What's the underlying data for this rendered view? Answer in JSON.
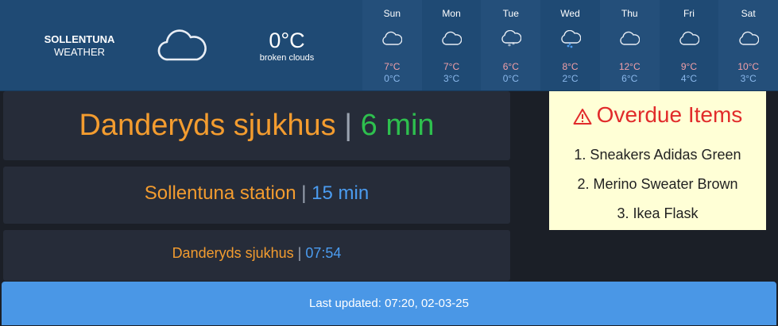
{
  "weather": {
    "city": "SOLLENTUNA",
    "subtitle": "WEATHER",
    "current_temp": "0°C",
    "current_desc": "broken clouds",
    "current_icon": "cloud-icon",
    "forecast": [
      {
        "day": "Sun",
        "icon": "cloud-icon",
        "hi": "7°C",
        "lo": "0°C"
      },
      {
        "day": "Mon",
        "icon": "cloud-icon",
        "hi": "7°C",
        "lo": "3°C"
      },
      {
        "day": "Tue",
        "icon": "snow-cloud-icon",
        "hi": "6°C",
        "lo": "0°C"
      },
      {
        "day": "Wed",
        "icon": "rain-cloud-icon",
        "hi": "8°C",
        "lo": "2°C"
      },
      {
        "day": "Thu",
        "icon": "cloud-icon",
        "hi": "12°C",
        "lo": "6°C"
      },
      {
        "day": "Fri",
        "icon": "cloud-icon",
        "hi": "9°C",
        "lo": "4°C"
      },
      {
        "day": "Sat",
        "icon": "cloud-icon",
        "hi": "10°C",
        "lo": "3°C"
      }
    ]
  },
  "transit": [
    {
      "place": "Danderyds sjukhus",
      "separator": "|",
      "time": "6 min"
    },
    {
      "place": "Sollentuna station",
      "separator": "|",
      "time": "15 min"
    },
    {
      "place": "Danderyds sjukhus",
      "separator": "|",
      "time": "07:54"
    }
  ],
  "overdue": {
    "title": "Overdue Items",
    "icon": "warning-icon",
    "items": [
      "1. Sneakers Adidas Green",
      "2. Merino Sweater Brown",
      "3. Ikea Flask"
    ]
  },
  "footer": {
    "last_updated": "Last updated: 07:20, 02-03-25"
  },
  "colors": {
    "header_bg": "#1f4a74",
    "panel_bg": "#262c39",
    "orange": "#f39c2f",
    "green": "#2ec04e",
    "blue": "#4b9cf0",
    "alert_red": "#e12b2b",
    "overdue_bg": "#ffffd6",
    "footer_bg": "#4a97e6"
  }
}
